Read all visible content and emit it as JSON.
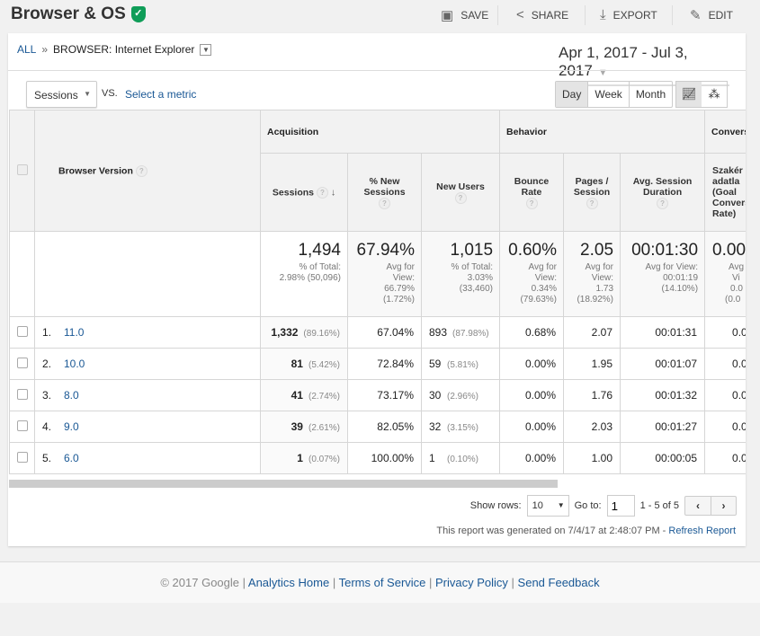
{
  "header": {
    "title": "Browser & OS",
    "actions": [
      {
        "icon": "save-icon",
        "label": "SAVE"
      },
      {
        "icon": "share-icon",
        "label": "SHARE"
      },
      {
        "icon": "export-icon",
        "label": "EXPORT"
      },
      {
        "icon": "edit-icon",
        "label": "EDIT"
      }
    ]
  },
  "breadcrumb": {
    "all": "ALL",
    "sep": "»",
    "current": "BROWSER: Internet Explorer"
  },
  "date_range": "Apr 1, 2017 - Jul 3, 2017",
  "controls": {
    "metric": "Sessions",
    "vs": "VS.",
    "select_metric": "Select a metric",
    "periods": [
      "Day",
      "Week",
      "Month"
    ],
    "active_period": "Day"
  },
  "table": {
    "groups": {
      "acquisition": "Acquisition",
      "behavior": "Behavior",
      "conversions": "Convers"
    },
    "headers": {
      "dimension": "Browser Version",
      "sessions": "Sessions",
      "new_sessions": "% New Sessions",
      "new_users": "New Users",
      "bounce": "Bounce Rate",
      "pages": "Pages / Session",
      "duration": "Avg. Session Duration",
      "conv": "Szakér adatla (Goal Convers Rate)"
    },
    "totals": {
      "sessions": {
        "value": "1,494",
        "l1": "% of Total:",
        "l2": "2.98% (50,096)"
      },
      "new_sessions": {
        "value": "67.94%",
        "l1": "Avg for",
        "l2": "View:",
        "l3": "66.79%",
        "l4": "(1.72%)"
      },
      "new_users": {
        "value": "1,015",
        "l1": "% of Total:",
        "l2": "3.03%",
        "l3": "(33,460)"
      },
      "bounce": {
        "value": "0.60%",
        "l1": "Avg for",
        "l2": "View:",
        "l3": "0.34%",
        "l4": "(79.63%)"
      },
      "pages": {
        "value": "2.05",
        "l1": "Avg for",
        "l2": "View:",
        "l3": "1.73",
        "l4": "(18.92%)"
      },
      "duration": {
        "value": "00:01:30",
        "l1": "Avg for View:",
        "l2": "00:01:19",
        "l3": "(14.10%)"
      },
      "conv": {
        "value": "0.00",
        "l1": "Avg",
        "l2": "Vi",
        "l3": "0.0",
        "l4": "(0.0"
      }
    },
    "rows": [
      {
        "n": "1.",
        "version": "11.0",
        "sessions": "1,332",
        "sessions_pct": "(89.16%)",
        "new_sessions": "67.04%",
        "new_users": "893",
        "new_users_pct": "(87.98%)",
        "bounce": "0.68%",
        "pages": "2.07",
        "duration": "00:01:31",
        "conv": "0.0"
      },
      {
        "n": "2.",
        "version": "10.0",
        "sessions": "81",
        "sessions_pct": "(5.42%)",
        "new_sessions": "72.84%",
        "new_users": "59",
        "new_users_pct": "(5.81%)",
        "bounce": "0.00%",
        "pages": "1.95",
        "duration": "00:01:07",
        "conv": "0.0"
      },
      {
        "n": "3.",
        "version": "8.0",
        "sessions": "41",
        "sessions_pct": "(2.74%)",
        "new_sessions": "73.17%",
        "new_users": "30",
        "new_users_pct": "(2.96%)",
        "bounce": "0.00%",
        "pages": "1.76",
        "duration": "00:01:32",
        "conv": "0.0"
      },
      {
        "n": "4.",
        "version": "9.0",
        "sessions": "39",
        "sessions_pct": "(2.61%)",
        "new_sessions": "82.05%",
        "new_users": "32",
        "new_users_pct": "(3.15%)",
        "bounce": "0.00%",
        "pages": "2.03",
        "duration": "00:01:27",
        "conv": "0.0"
      },
      {
        "n": "5.",
        "version": "6.0",
        "sessions": "1",
        "sessions_pct": "(0.07%)",
        "new_sessions": "100.00%",
        "new_users": "1",
        "new_users_pct": "(0.10%)",
        "bounce": "0.00%",
        "pages": "1.00",
        "duration": "00:00:05",
        "conv": "0.0"
      }
    ]
  },
  "pager": {
    "show_rows_label": "Show rows:",
    "show_rows": "10",
    "goto_label": "Go to:",
    "goto": "1",
    "range": "1 - 5 of 5"
  },
  "generated": {
    "text": "This report was generated on 7/4/17 at 2:48:07 PM -",
    "refresh": "Refresh Report"
  },
  "footer": {
    "copyright": "© 2017 Google",
    "links": [
      "Analytics Home",
      "Terms of Service",
      "Privacy Policy",
      "Send Feedback"
    ]
  }
}
